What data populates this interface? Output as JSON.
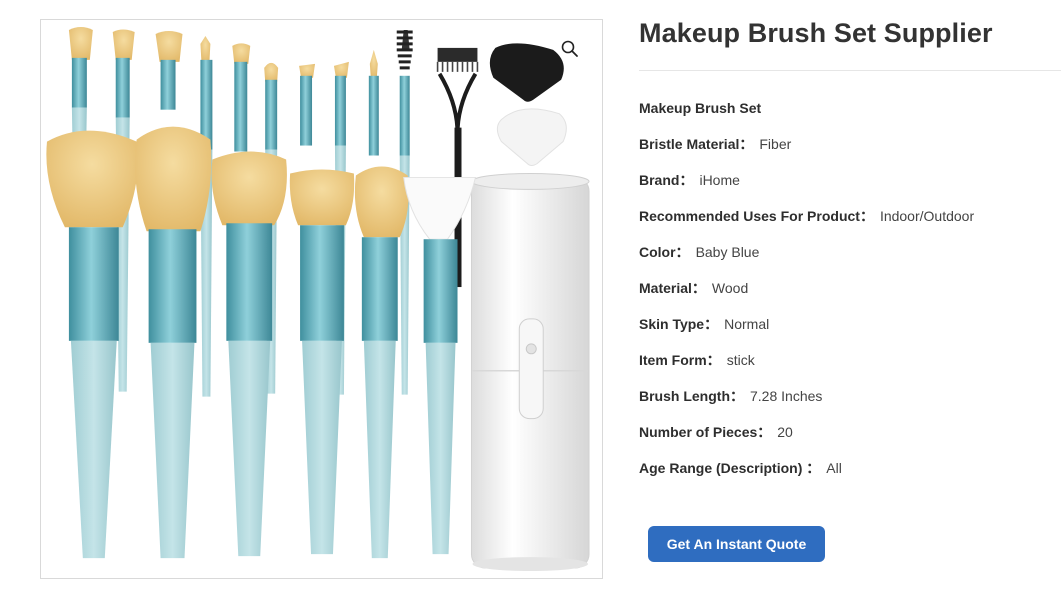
{
  "product": {
    "title": "Makeup Brush Set Supplier",
    "image_alt": "Makeup Brush Set",
    "zoom_icon": "magnifier-icon"
  },
  "specs": [
    {
      "label": "Makeup Brush Set",
      "value": ""
    },
    {
      "label": "Bristle Material：",
      "value": "Fiber"
    },
    {
      "label": "Brand：",
      "value": "iHome"
    },
    {
      "label": "Recommended Uses For Product：",
      "value": "Indoor/Outdoor"
    },
    {
      "label": "Color：",
      "value": "Baby Blue"
    },
    {
      "label": "Material：",
      "value": "Wood"
    },
    {
      "label": "Skin Type：",
      "value": "Normal"
    },
    {
      "label": "Item Form：",
      "value": "stick"
    },
    {
      "label": "Brush Length：",
      "value": "7.28 Inches"
    },
    {
      "label": "Number of Pieces：",
      "value": "20"
    },
    {
      "label": "Age Range (Description) ：",
      "value": "All"
    }
  ],
  "cta": {
    "label": "Get An Instant Quote"
  },
  "colors": {
    "accent": "#2f6dc0",
    "handle": "#a9d3d8",
    "ferrule": "#5aa7b5",
    "bristle": "#ecc97e"
  }
}
